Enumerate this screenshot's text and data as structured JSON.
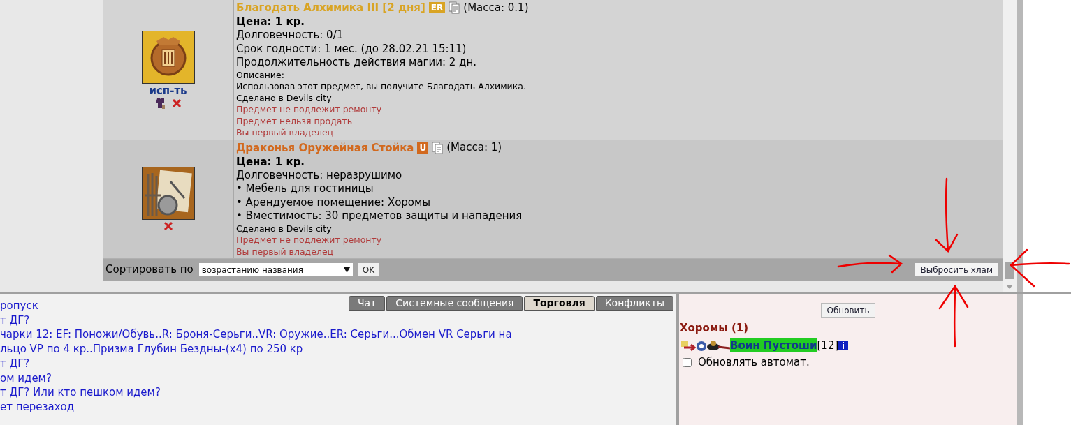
{
  "items": [
    {
      "title": "Благодать Алхимика III [2 дня]",
      "color": "#d9a424",
      "badge": "ER",
      "mass": "(Масса: 0.1)",
      "price": "Цена: 1 кр.",
      "kind": "medal",
      "action": "исп-ть",
      "lines": [
        {
          "kind": "big",
          "text": "Долговечность: 0/1"
        },
        {
          "kind": "big",
          "text": "Срок годности: 1 мес. (до 28.02.21 15:11)"
        },
        {
          "kind": "big",
          "text": "Продолжительность действия магии: 2 дн."
        },
        {
          "kind": "small",
          "text": "Описание:"
        },
        {
          "kind": "small",
          "text": "Использовав этот предмет, вы получите Благодать Алхимика."
        },
        {
          "kind": "small",
          "text": "Сделано в Devils city"
        },
        {
          "kind": "warning",
          "text": "Предмет не подлежит ремонту"
        },
        {
          "kind": "warning",
          "text": "Предмет нельзя продать"
        },
        {
          "kind": "warning",
          "text": "Вы первый владелец"
        }
      ]
    },
    {
      "title": "Драконья Оружейная Стойка",
      "color": "#d2691e",
      "badge": "U",
      "mass": "(Масса: 1)",
      "price": "Цена: 1 кр.",
      "kind": "rack",
      "lines": [
        {
          "kind": "big",
          "text": "Долговечность: неразрушимо"
        },
        {
          "kind": "big",
          "text": "• Мебель для гостиницы"
        },
        {
          "kind": "big",
          "text": "• Арендуемое помещение: Хоромы"
        },
        {
          "kind": "big",
          "text": "• Вместимость: 30 предметов защиты и нападения"
        },
        {
          "kind": "small",
          "text": "Сделано в Devils city"
        },
        {
          "kind": "warning",
          "text": "Предмет не подлежит ремонту"
        },
        {
          "kind": "warning",
          "text": "Вы первый владелец"
        }
      ]
    }
  ],
  "sort": {
    "label": "Сортировать по",
    "value": "возрастанию названия",
    "ok": "OK",
    "junk_button": "Выбросить хлам"
  },
  "tabs": [
    {
      "label": "Чат",
      "selected": false
    },
    {
      "label": "Системные сообщения",
      "selected": false
    },
    {
      "label": "Торговля",
      "selected": true
    },
    {
      "label": "Конфликты",
      "selected": false
    }
  ],
  "chat_lines": [
    "ропуск",
    "т ДГ?",
    "чарки 12: EF: Поножи/Обувь..R: Броня-Серьги..VR: Оружие..ER: Серьги...Обмен VR Серьги на",
    "льцо VP по 4 кр..Призма Глубин Бездны-(x4) по 250 кр",
    "т ДГ?",
    "ом идем?",
    "т ДГ? Или кто пешком идем?",
    "ет перезаход"
  ],
  "room": {
    "refresh": "Обновить",
    "title": "Хоромы (1)",
    "player": "Воин Пустоши",
    "level": "[12]",
    "auto_label": "Обновлять автомат.",
    "auto_checked": false
  }
}
